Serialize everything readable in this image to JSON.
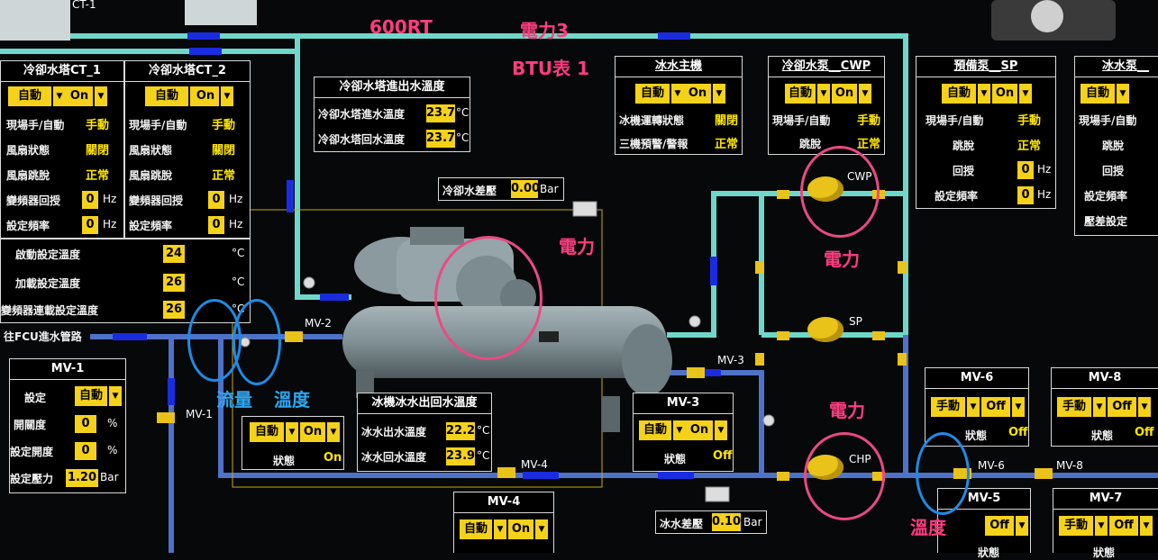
{
  "annotations": {
    "rt": "600RT",
    "power3": "電力3",
    "btu": "BTU表 1",
    "power_chiller": "電力",
    "power_cwp": "電力",
    "power_chp": "電力",
    "flow": "流量",
    "temp_left": "溫度",
    "temp_right": "溫度"
  },
  "top_labels": {
    "ct1": "CT-1"
  },
  "ct1": {
    "title": "冷卻水塔CT_1",
    "mode": "自動",
    "state": "On",
    "rows": [
      {
        "label": "現場手/自動",
        "value": "手動"
      },
      {
        "label": "風扇狀態",
        "value": "關閉"
      },
      {
        "label": "風扇跳脫",
        "value": "正常"
      },
      {
        "label": "變頻器回授",
        "value": "0",
        "unit": "Hz"
      },
      {
        "label": "設定頻率",
        "value": "0",
        "unit": "Hz"
      }
    ]
  },
  "ct2": {
    "title": "冷卻水塔CT_2",
    "mode": "自動",
    "state": "On",
    "rows": [
      {
        "label": "現場手/自動",
        "value": "手動"
      },
      {
        "label": "風扇狀態",
        "value": "關閉"
      },
      {
        "label": "風扇跳脫",
        "value": "正常"
      },
      {
        "label": "變頻器回授",
        "value": "0",
        "unit": "Hz"
      },
      {
        "label": "設定頻率",
        "value": "0",
        "unit": "Hz"
      }
    ]
  },
  "ct_settings": [
    {
      "label": "啟動設定溫度",
      "value": "24",
      "unit": "°C"
    },
    {
      "label": "加載設定溫度",
      "value": "26",
      "unit": "°C"
    },
    {
      "label": "變頻器連載設定溫度",
      "value": "26",
      "unit": "°C"
    }
  ],
  "cooling_tower_temp": {
    "title": "冷卻水塔進出水溫度",
    "rows": [
      {
        "label": "冷卻水塔進水溫度",
        "value": "23.7",
        "unit": "°C"
      },
      {
        "label": "冷卻水塔回水溫度",
        "value": "23.7",
        "unit": "°C"
      }
    ]
  },
  "cooling_dp": {
    "label": "冷卻水差壓",
    "value": "0.00",
    "unit": "Bar"
  },
  "chiller_main": {
    "title": "冰水主機",
    "mode": "自動",
    "state": "On",
    "rows": [
      {
        "label": "冰機運轉狀態",
        "value": "關閉"
      },
      {
        "label": "三機預警/警報",
        "value": "正常"
      }
    ]
  },
  "cwp": {
    "title": "冷卻水泵__CWP",
    "mode": "自動",
    "state": "On",
    "rows": [
      {
        "label": "現場手/自動",
        "value": "手動"
      },
      {
        "label": "跳脫",
        "value": "正常"
      }
    ]
  },
  "sp": {
    "title": "預備泵__SP",
    "mode": "自動",
    "state": "On",
    "rows": [
      {
        "label": "現場手/自動",
        "value": "手動"
      },
      {
        "label": "跳脫",
        "value": "正常"
      },
      {
        "label": "回授",
        "value": "0",
        "unit": "Hz"
      },
      {
        "label": "設定頻率",
        "value": "0",
        "unit": "Hz"
      }
    ]
  },
  "chp": {
    "title": "冰水泵__",
    "mode": "自動",
    "rows": [
      {
        "label": "現場手/自動"
      },
      {
        "label": "跳脫"
      },
      {
        "label": "回授"
      },
      {
        "label": "設定頻率"
      },
      {
        "label": "壓差設定"
      }
    ]
  },
  "fcu_label": "往FCU進水管路",
  "mv1": {
    "title": "MV-1",
    "rows": [
      {
        "label": "設定",
        "mode": "自動"
      },
      {
        "label": "開關度",
        "value": "0",
        "unit": "%"
      },
      {
        "label": "設定開度",
        "value": "0",
        "unit": "%"
      },
      {
        "label": "設定壓力",
        "value": "1.20",
        "unit": "Bar"
      }
    ]
  },
  "mv2_box": {
    "mode": "自動",
    "state": "On",
    "status_label": "狀態",
    "status": "On"
  },
  "chilled_temp": {
    "title": "冰機冰水出回水溫度",
    "rows": [
      {
        "label": "冰水出水溫度",
        "value": "22.2",
        "unit": "°C"
      },
      {
        "label": "冰水回水溫度",
        "value": "23.9",
        "unit": "°C"
      }
    ]
  },
  "mv3": {
    "title": "MV-3",
    "mode": "自動",
    "state": "On",
    "status_label": "狀態",
    "status": "Off"
  },
  "mv4": {
    "title": "MV-4",
    "mode": "自動",
    "state": "On"
  },
  "chilled_dp": {
    "label": "冰水差壓",
    "value": "0.10",
    "unit": "Bar"
  },
  "mv6": {
    "title": "MV-6",
    "mode": "手動",
    "state": "Off",
    "status_label": "狀態",
    "status": "Off"
  },
  "mv8": {
    "title": "MV-8",
    "mode": "手動",
    "state": "Off",
    "status_label": "狀態",
    "status": "Off"
  },
  "mv5": {
    "title": "MV-5",
    "state": "Off",
    "status_label": "狀態"
  },
  "mv7": {
    "title": "MV-7",
    "mode": "手動",
    "state": "Off",
    "status_label": "狀態"
  },
  "pipe_labels": {
    "mv1": "MV-1",
    "mv2": "MV-2",
    "mv3": "MV-3",
    "mv4": "MV-4",
    "mv6": "MV-6",
    "mv8": "MV-8",
    "cwp": "CWP",
    "sp": "SP",
    "chp": "CHP"
  },
  "colors": {
    "accent_yellow": "#f5d21a",
    "pipe_cyan": "#66d6c8",
    "pipe_blue": "#4c6fc7",
    "annotation_pink": "#ff3d7f",
    "annotation_blue": "#2ea6f0"
  }
}
